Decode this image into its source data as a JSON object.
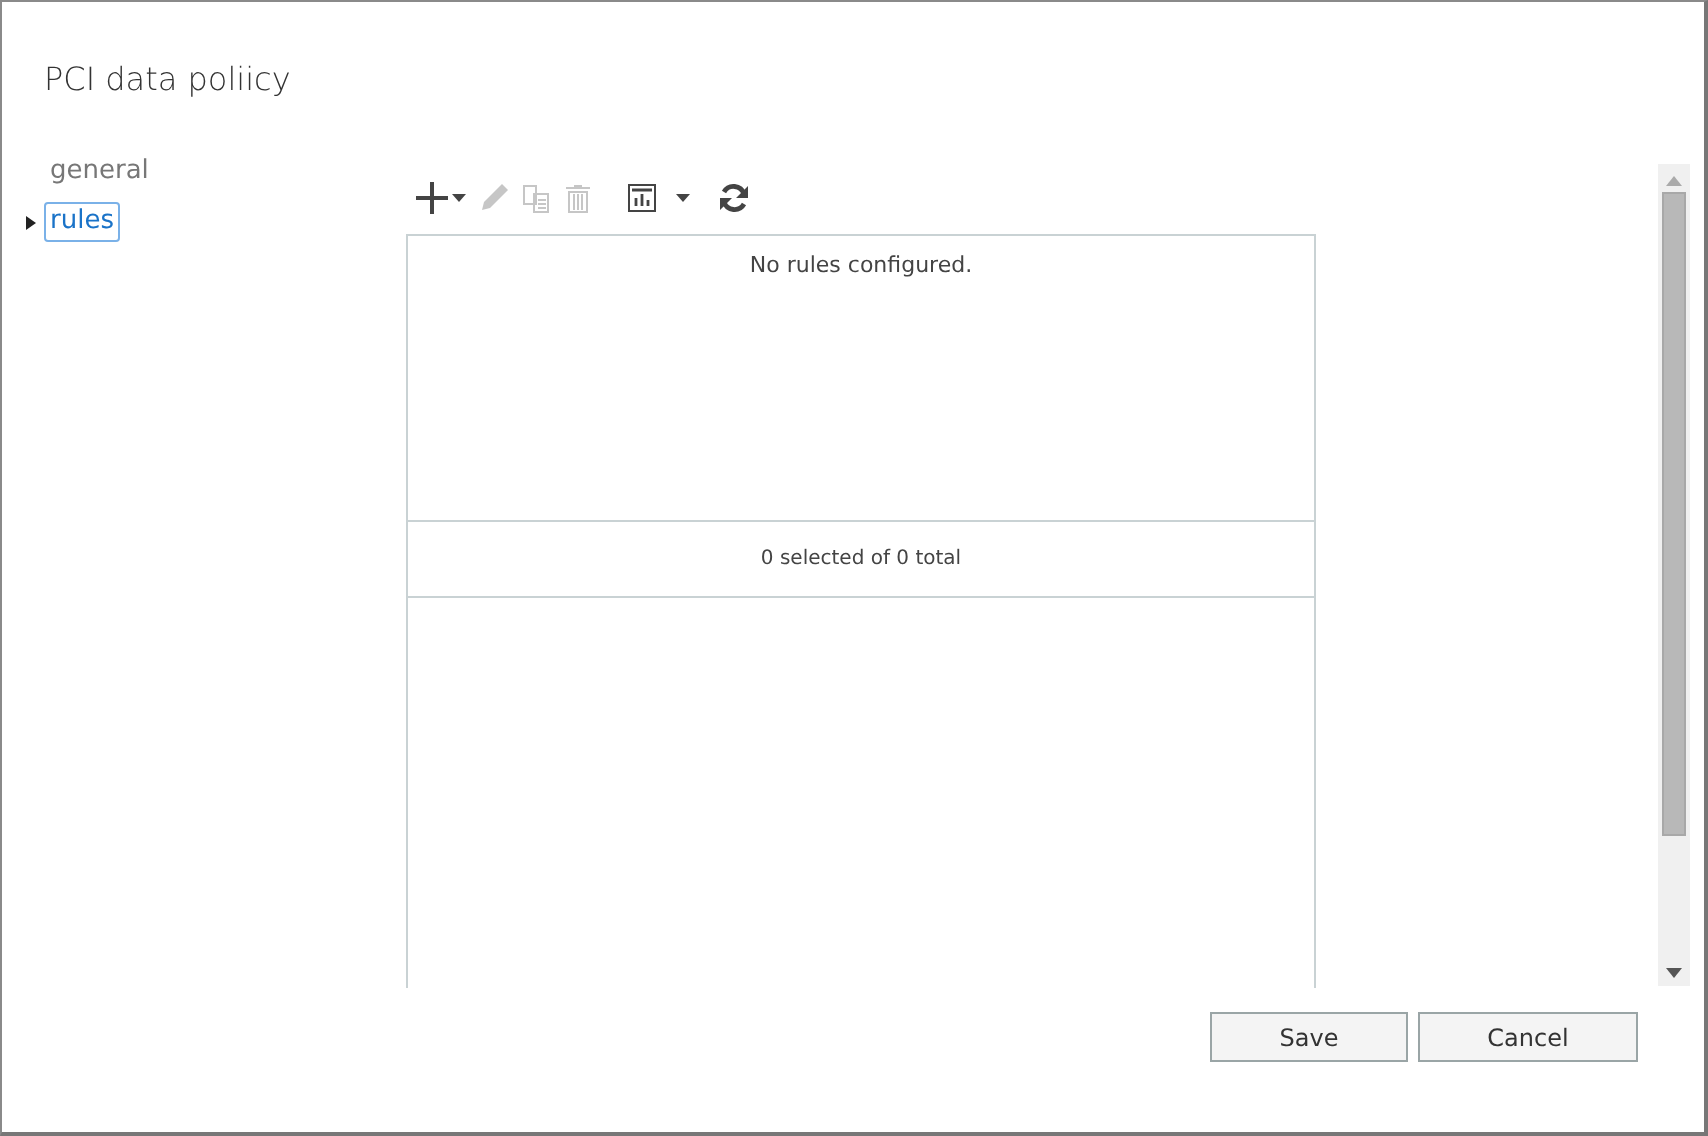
{
  "window": {
    "title": "PCI data poliicy"
  },
  "nav": [
    {
      "label": "general",
      "selected": false
    },
    {
      "label": "rules",
      "selected": true
    }
  ],
  "toolbar": [
    {
      "kind": "add",
      "disabled": false
    },
    {
      "kind": "edit",
      "disabled": true
    },
    {
      "kind": "copy",
      "disabled": true
    },
    {
      "kind": "delete",
      "disabled": true
    },
    {
      "kind": "report",
      "disabled": false
    },
    {
      "kind": "refresh",
      "disabled": false
    }
  ],
  "list": {
    "empty_message": "No rules configured.",
    "status": "0 selected of 0 total"
  },
  "buttons": [
    "Save",
    "Cancel"
  ]
}
